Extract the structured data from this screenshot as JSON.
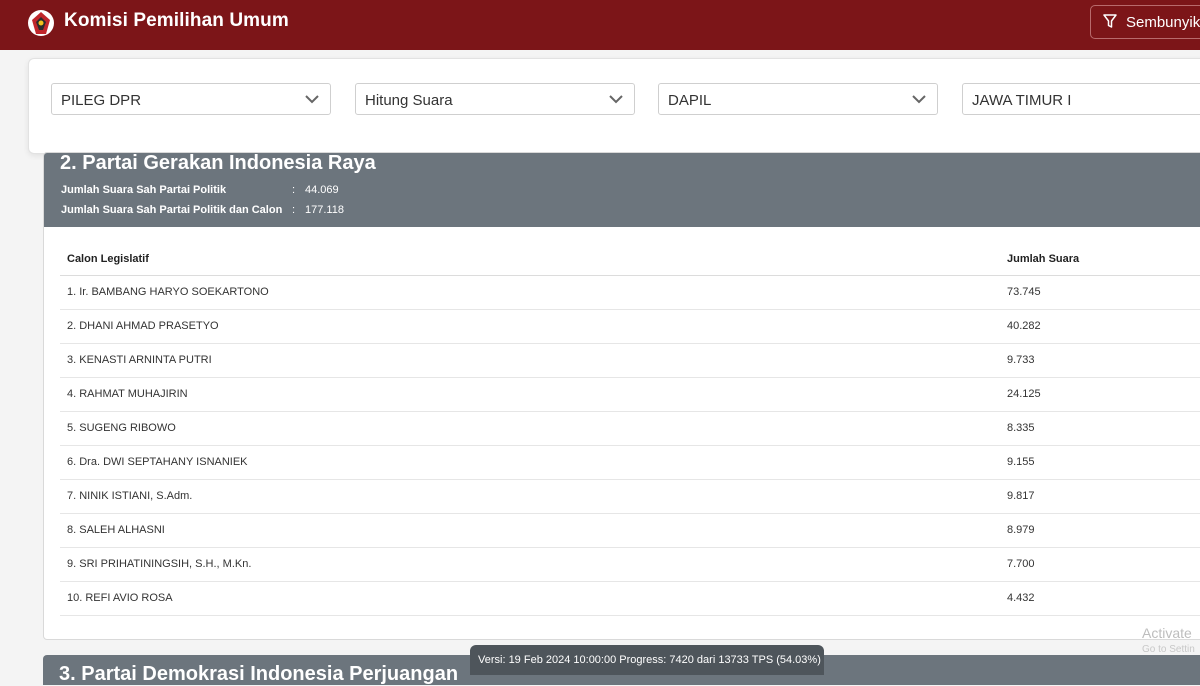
{
  "header": {
    "title": "Komisi Pemilihan Umum",
    "hide_button": "Sembunyik",
    "brand_color": "#7c1518"
  },
  "filters": [
    {
      "value": "PILEG DPR"
    },
    {
      "value": "Hitung Suara"
    },
    {
      "value": "DAPIL"
    },
    {
      "value": "JAWA TIMUR I"
    }
  ],
  "party": {
    "title": "2. Partai Gerakan Indonesia Raya",
    "summary": [
      {
        "label": "Jumlah Suara Sah Partai Politik",
        "sep": ":",
        "value": "44.069"
      },
      {
        "label": "Jumlah Suara Sah Partai Politik dan Calon",
        "sep": ":",
        "value": "177.118"
      }
    ],
    "table": {
      "headers": [
        "Calon Legislatif",
        "Jumlah Suara"
      ],
      "rows": [
        {
          "name": "1. Ir. BAMBANG HARYO SOEKARTONO",
          "votes": "73.745"
        },
        {
          "name": "2. DHANI AHMAD PRASETYO",
          "votes": "40.282"
        },
        {
          "name": "3. KENASTI ARNINTA PUTRI",
          "votes": "9.733"
        },
        {
          "name": "4. RAHMAT MUHAJIRIN",
          "votes": "24.125"
        },
        {
          "name": "5. SUGENG RIBOWO",
          "votes": "8.335"
        },
        {
          "name": "6. Dra. DWI SEPTAHANY ISNANIEK",
          "votes": "9.155"
        },
        {
          "name": "7. NINIK ISTIANI, S.Adm.",
          "votes": "9.817"
        },
        {
          "name": "8. SALEH ALHASNI",
          "votes": "8.979"
        },
        {
          "name": "9. SRI PRIHATININGSIH, S.H., M.Kn.",
          "votes": "7.700"
        },
        {
          "name": "10. REFI AVIO ROSA",
          "votes": "4.432"
        }
      ]
    }
  },
  "next_party": {
    "title": "3. Partai Demokrasi Indonesia Perjuangan"
  },
  "footer": {
    "version": "Versi: 19 Feb 2024 10:00:00 Progress: 7420 dari 13733 TPS (54.03%)"
  },
  "watermark": {
    "line1": "Activate",
    "line2": "Go to Settin"
  }
}
